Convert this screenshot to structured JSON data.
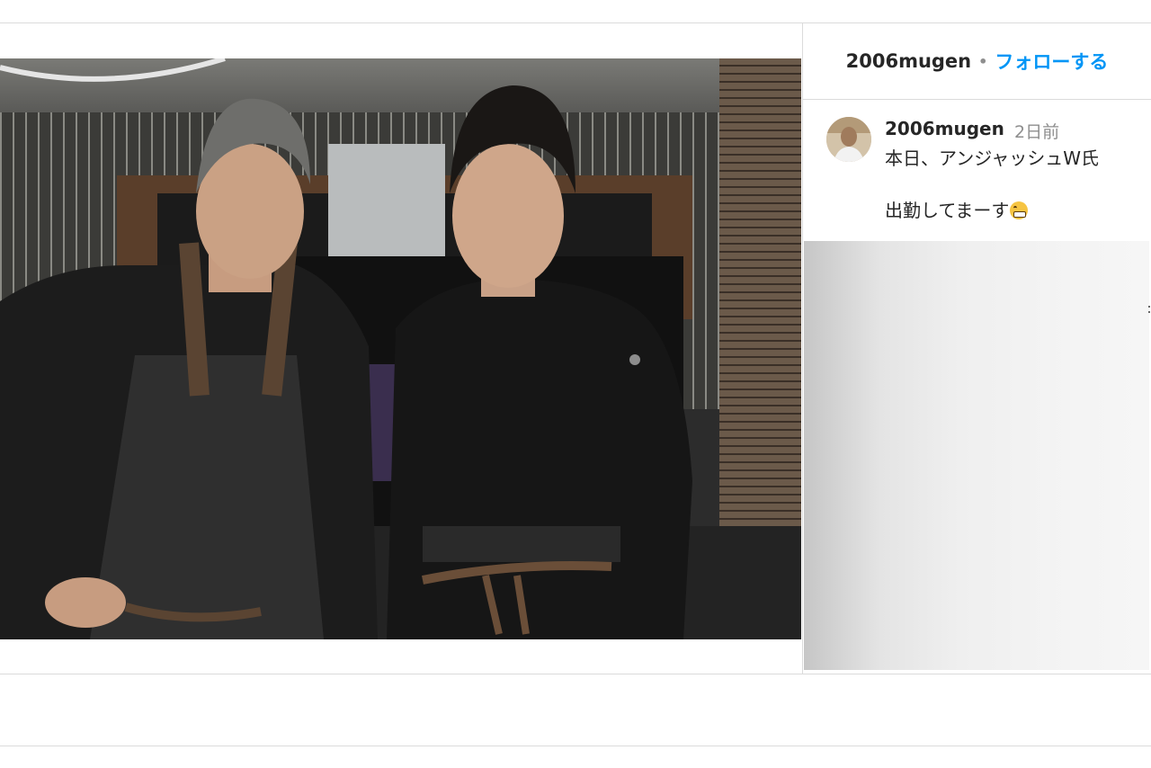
{
  "post": {
    "username": "2006mugen",
    "separator": "•",
    "follow_label": "フォローする"
  },
  "caption": {
    "username": "2006mugen",
    "time": "2日前",
    "line1": "本日、アンジャッシュW氏",
    "line2": "出勤してまーす",
    "emoji": "grinning-face-emoji"
  },
  "colors": {
    "follow_blue": "#0095f6",
    "border": "#dbdbdb",
    "meta_gray": "#8e8e8e"
  }
}
